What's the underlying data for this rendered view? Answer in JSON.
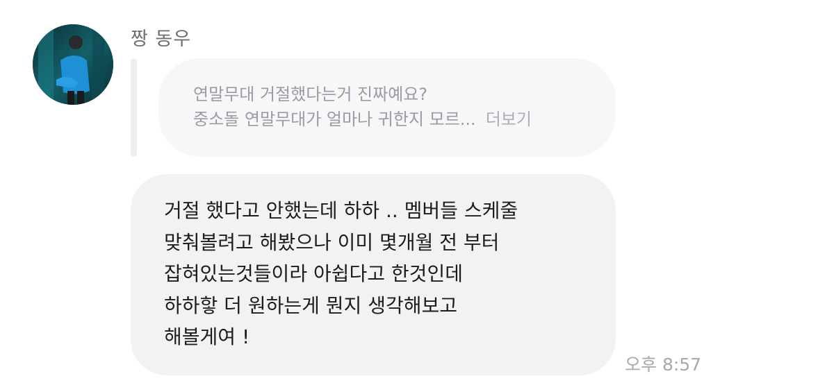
{
  "message": {
    "sender_name": "짱 동우",
    "quoted": {
      "line1": "연말무대 거절했다는거 진짜예요?",
      "line2": "중소돌 연말무대가 얼마나 귀한지 모르...",
      "more_label": "더보기"
    },
    "body_lines": [
      "거절 했다고 안했는데 하하 .. 멤버들 스케줄",
      "맞춰볼려고 해봤으나 이미 몇개월 전 부터",
      "잡혀있는것들이라 아쉽다고 한것인데",
      "하하핳 더 원하는게 뭔지 생각해보고",
      "해볼게여 !"
    ],
    "time": "오후 8:57"
  },
  "colors": {
    "sender_text": "#6e6e72",
    "quote_bubble_bg": "#f7f7f9",
    "quote_text": "#9b9ba0",
    "main_bubble_bg": "#f2f2f4",
    "main_text": "#1c1c1e",
    "timestamp_text": "#a8a8ad",
    "avatar_accent": "#1f8fd6"
  }
}
